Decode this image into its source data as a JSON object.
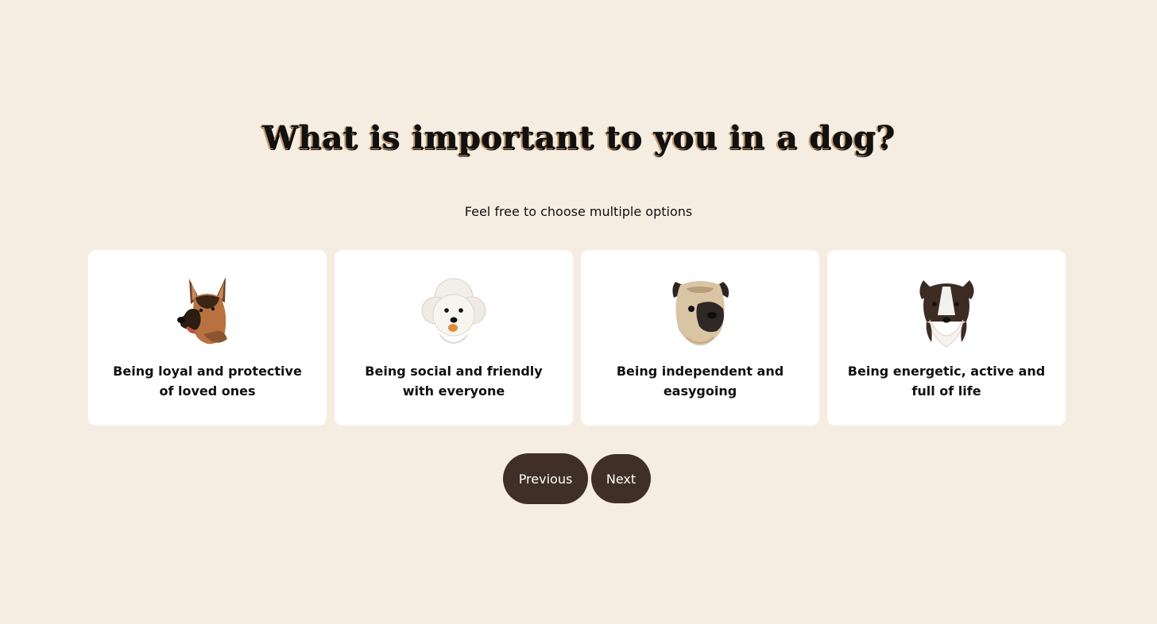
{
  "header": {
    "title": "What is important to you in a dog?",
    "subtitle": "Feel free to choose multiple options"
  },
  "options": [
    {
      "label": "Being loyal and protective of loved ones",
      "icon": "german-shepherd-icon"
    },
    {
      "label": "Being social and friendly with everyone",
      "icon": "bichon-frise-icon"
    },
    {
      "label": "Being independent and easygoing",
      "icon": "pug-icon"
    },
    {
      "label": "Being energetic, active and full of life",
      "icon": "border-collie-icon"
    }
  ],
  "navigation": {
    "previous_label": "Previous",
    "next_label": "Next"
  },
  "colors": {
    "background": "#f5ede1",
    "card": "#ffffff",
    "button": "#3f2f26",
    "button_text": "#ffffff"
  }
}
